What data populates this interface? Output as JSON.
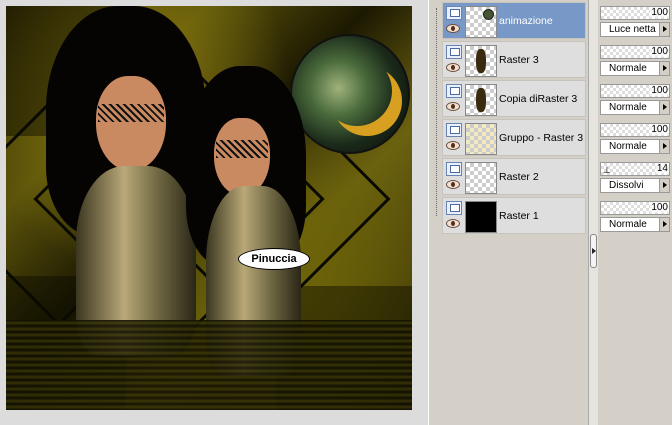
{
  "canvas": {
    "watermark_text": "Pinuccia"
  },
  "layers": [
    {
      "name": "animazione",
      "selected": true,
      "thumb": "moon-transparent"
    },
    {
      "name": "Raster 3",
      "selected": false,
      "thumb": "figure"
    },
    {
      "name": "Copia diRaster 3",
      "selected": false,
      "thumb": "figure"
    },
    {
      "name": "Gruppo - Raster 3",
      "selected": false,
      "thumb": "gold-pattern"
    },
    {
      "name": "Raster 2",
      "selected": false,
      "thumb": "transparent"
    },
    {
      "name": "Raster 1",
      "selected": false,
      "thumb": "black"
    }
  ],
  "layer_props": [
    {
      "opacity": "100",
      "blend": "Luce netta"
    },
    {
      "opacity": "100",
      "blend": "Normale"
    },
    {
      "opacity": "100",
      "blend": "Normale"
    },
    {
      "opacity": "100",
      "blend": "Normale"
    },
    {
      "opacity": "14",
      "blend": "Dissolvi"
    },
    {
      "opacity": "100",
      "blend": "Normale"
    }
  ],
  "colors": {
    "selected_layer": "#7898c8",
    "panel_bg": "#d4d0c8"
  },
  "icons": {
    "visibility": "eye-icon",
    "layer_type": "raster-layer-icon",
    "dropdown": "triangle-right-icon"
  }
}
